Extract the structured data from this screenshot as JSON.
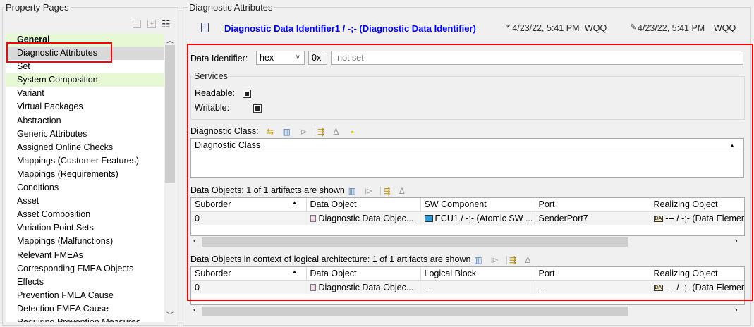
{
  "left_panel": {
    "title": "Property Pages",
    "toolbar": [
      "collapse-all-icon",
      "expand-all-icon",
      "tree-view-icon"
    ],
    "items": [
      {
        "label": "General",
        "style": "green-bold"
      },
      {
        "label": "Diagnostic Attributes",
        "style": "selected"
      },
      {
        "label": "Set"
      },
      {
        "label": "System Composition",
        "style": "green"
      },
      {
        "label": "Variant"
      },
      {
        "label": "Virtual Packages"
      },
      {
        "label": "Abstraction"
      },
      {
        "label": "Generic Attributes"
      },
      {
        "label": "Assigned Online Checks"
      },
      {
        "label": "Mappings (Customer Features)"
      },
      {
        "label": "Mappings (Requirements)"
      },
      {
        "label": "Conditions"
      },
      {
        "label": "Asset"
      },
      {
        "label": "Asset Composition"
      },
      {
        "label": "Variation Point Sets"
      },
      {
        "label": "Mappings (Malfunctions)"
      },
      {
        "label": "Relevant FMEAs"
      },
      {
        "label": "Corresponding FMEA Objects"
      },
      {
        "label": "Effects"
      },
      {
        "label": "Prevention FMEA Cause"
      },
      {
        "label": "Detection FMEA Cause"
      },
      {
        "label": "Requiring Prevention Measures"
      }
    ]
  },
  "right_panel": {
    "title": "Diagnostic Attributes",
    "header": {
      "name": "Diagnostic Data Identifier1 / -;- (Diagnostic Data Identifier)",
      "created": "* 4/23/22, 5:41 PM",
      "created_by": "WQQ",
      "modified": "4/23/22, 5:41 PM",
      "modified_by": "WQQ"
    },
    "data_identifier": {
      "label": "Data Identifier:",
      "format": "hex",
      "prefix": "0x",
      "placeholder": "-not set-"
    },
    "services": {
      "title": "Services",
      "readable_label": "Readable:",
      "readable": true,
      "writable_label": "Writable:",
      "writable": true
    },
    "diagnostic_class": {
      "label": "Diagnostic Class:",
      "column": "Diagnostic Class"
    },
    "data_objects": {
      "label": "Data Objects: 1 of 1 artifacts are shown",
      "columns": [
        "Suborder",
        "Data Object",
        "SW Component",
        "Port",
        "Realizing Object"
      ],
      "rows": [
        [
          "0",
          "Diagnostic Data Objec...",
          "ECU1 / -;- (Atomic SW ...",
          "SenderPort7",
          "--- / -;- (Data Elemen"
        ]
      ]
    },
    "logical": {
      "label": "Data Objects in context of logical architecture: 1 of 1 artifacts are shown",
      "columns": [
        "Suborder",
        "Data Object",
        "Logical Block",
        "Port",
        "Realizing Object"
      ],
      "rows": [
        [
          "0",
          "Diagnostic Data Objec...",
          "---",
          "---",
          "--- / -;- (Data Elemen"
        ]
      ]
    },
    "highlight_color": "#ff0000",
    "title_color": "#0000ee"
  }
}
